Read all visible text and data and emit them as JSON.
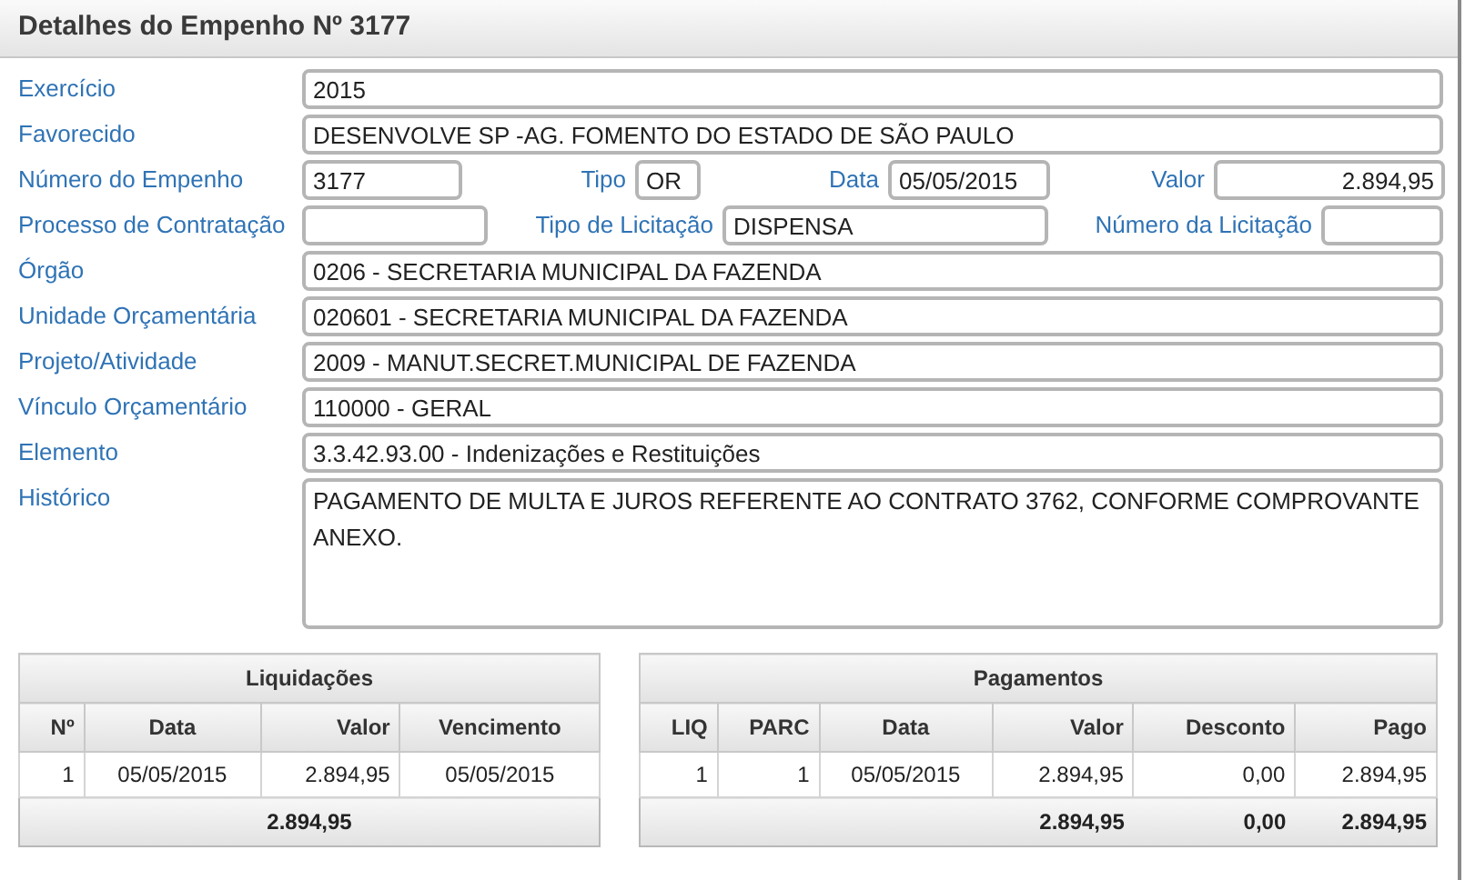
{
  "window": {
    "title": "Detalhes do Empenho Nº 3177"
  },
  "form": {
    "lines": [
      {
        "fields": [
          {
            "label": "Exercício",
            "value": "2015"
          }
        ]
      },
      {
        "fields": [
          {
            "label": "Favorecido",
            "value": "DESENVOLVE SP -AG. FOMENTO DO ESTADO DE SÃO PAULO"
          }
        ]
      },
      {
        "fields": [
          {
            "label": "Número do Empenho",
            "value": "3177"
          },
          {
            "label": "Tipo",
            "value": "OR"
          },
          {
            "label": "Data",
            "value": "05/05/2015"
          },
          {
            "label": "Valor",
            "value": "2.894,95"
          }
        ]
      },
      {
        "fields": [
          {
            "label": "Processo de Contratação"
          },
          {
            "label": "Tipo de Licitação",
            "value": "DISPENSA"
          },
          {
            "label": "Número da Licitação"
          }
        ]
      },
      {
        "fields": [
          {
            "label": "Órgão",
            "value": "0206 - SECRETARIA MUNICIPAL DA FAZENDA"
          }
        ]
      },
      {
        "fields": [
          {
            "label": "Unidade Orçamentária",
            "value": "020601 - SECRETARIA MUNICIPAL DA FAZENDA"
          }
        ]
      },
      {
        "fields": [
          {
            "label": "Projeto/Atividade",
            "value": "2009 - MANUT.SECRET.MUNICIPAL DE FAZENDA"
          }
        ]
      },
      {
        "fields": [
          {
            "label": "Vínculo Orçamentário",
            "value": "110000 - GERAL"
          }
        ]
      },
      {
        "fields": [
          {
            "label": "Elemento",
            "value": "3.3.42.93.00 - Indenizações e Restituições"
          }
        ]
      },
      {
        "fields": [
          {
            "label": "Histórico",
            "value": "PAGAMENTO DE MULTA E JUROS REFERENTE AO CONTRATO 3762, CONFORME COMPROVANTE ANEXO.",
            "kind": "textarea"
          }
        ]
      }
    ]
  },
  "liquidacoes": {
    "title": "Liquidações",
    "columns": [
      "Nº",
      "Data",
      "Valor",
      "Vencimento"
    ],
    "rows": [
      [
        "1",
        "05/05/2015",
        "2.894,95",
        "05/05/2015"
      ]
    ],
    "total": "2.894,95"
  },
  "pagamentos": {
    "title": "Pagamentos",
    "columns": [
      "LIQ",
      "PARC",
      "Data",
      "Valor",
      "Desconto",
      "Pago"
    ],
    "rows": [
      [
        "1",
        "1",
        "05/05/2015",
        "2.894,95",
        "0,00",
        "2.894,95"
      ]
    ],
    "totals": {
      "valor": "2.894,95",
      "desconto": "0,00",
      "pago": "2.894,95"
    }
  }
}
